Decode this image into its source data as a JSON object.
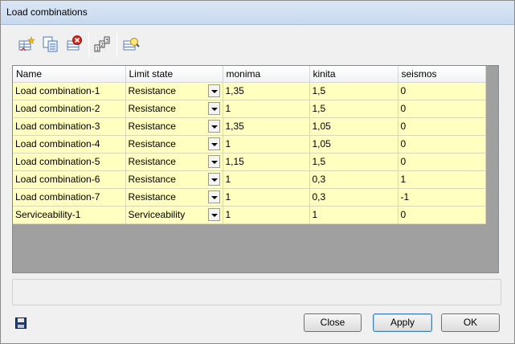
{
  "window": {
    "title": "Load combinations"
  },
  "toolbar": {
    "icons": [
      "add-combination-icon",
      "copy-combination-icon",
      "delete-combination-icon",
      "renumber-icon",
      "generate-combinations-icon"
    ]
  },
  "grid": {
    "columns": [
      "Name",
      "Limit state",
      "monima",
      "kinita",
      "seismos"
    ],
    "rows": [
      {
        "name": "Load combination-1",
        "limit_state": "Resistance",
        "monima": "1,35",
        "kinita": "1,5",
        "seismos": "0"
      },
      {
        "name": "Load combination-2",
        "limit_state": "Resistance",
        "monima": "1",
        "kinita": "1,5",
        "seismos": "0"
      },
      {
        "name": "Load combination-3",
        "limit_state": "Resistance",
        "monima": "1,35",
        "kinita": "1,05",
        "seismos": "0"
      },
      {
        "name": "Load combination-4",
        "limit_state": "Resistance",
        "monima": "1",
        "kinita": "1,05",
        "seismos": "0"
      },
      {
        "name": "Load combination-5",
        "limit_state": "Resistance",
        "monima": "1,15",
        "kinita": "1,5",
        "seismos": "0"
      },
      {
        "name": "Load combination-6",
        "limit_state": "Resistance",
        "monima": "1",
        "kinita": "0,3",
        "seismos": "1"
      },
      {
        "name": "Load combination-7",
        "limit_state": "Resistance",
        "monima": "1",
        "kinita": "0,3",
        "seismos": "-1"
      },
      {
        "name": "Serviceability-1",
        "limit_state": "Serviceability",
        "monima": "1",
        "kinita": "1",
        "seismos": "0"
      }
    ]
  },
  "buttons": {
    "close": "Close",
    "apply": "Apply",
    "ok": "OK"
  },
  "colors": {
    "row_background": "#ffffc0",
    "grid_empty": "#a0a0a0"
  }
}
